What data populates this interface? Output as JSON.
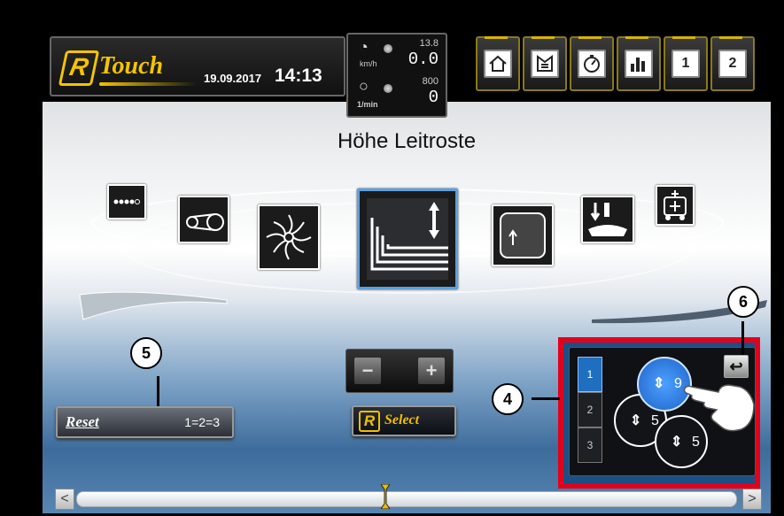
{
  "header": {
    "logo_letter": "R",
    "logo_text": "Touch",
    "date": "19.09.2017",
    "time": "14:13"
  },
  "gauges": {
    "speed_unit": "km/h",
    "speed_max": "13.8",
    "speed_value": "0.0",
    "rpm_unit": "1/min",
    "rpm_max": "800",
    "rpm_value": "0"
  },
  "tabs": [
    {
      "icon": "home-icon"
    },
    {
      "icon": "menu-icon"
    },
    {
      "icon": "stopwatch-icon"
    },
    {
      "icon": "bar-chart-icon"
    },
    {
      "icon": "window-1-icon",
      "label": "1"
    },
    {
      "icon": "window-2-icon",
      "label": "2"
    }
  ],
  "carousel": {
    "title": "Höhe Leitroste",
    "items": [
      {
        "icon": "chain-icon"
      },
      {
        "icon": "belt-drive-icon"
      },
      {
        "icon": "rotor-icon"
      },
      {
        "icon": "concave-height-icon",
        "selected": true
      },
      {
        "icon": "grate-icon"
      },
      {
        "icon": "pressure-icon"
      },
      {
        "icon": "machine-icon"
      }
    ]
  },
  "reset": {
    "label": "eset",
    "letter": "R",
    "value": "1=2=3"
  },
  "select": {
    "letter": "R",
    "label": "Select",
    "minus": "−",
    "plus": "+"
  },
  "preset_panel": {
    "numbers": [
      "1",
      "2",
      "3"
    ],
    "active_number": "1",
    "circles": [
      {
        "value": "9",
        "active": true
      },
      {
        "value": "5"
      },
      {
        "value": "5"
      }
    ],
    "back_symbol": "↩"
  },
  "scrollbar": {
    "left": "<",
    "right": ">"
  },
  "callouts": [
    "4",
    "5",
    "6"
  ],
  "colors": {
    "accent": "#f5c400",
    "highlight_frame": "#e3001a",
    "active_blue": "#1e6fc0"
  }
}
